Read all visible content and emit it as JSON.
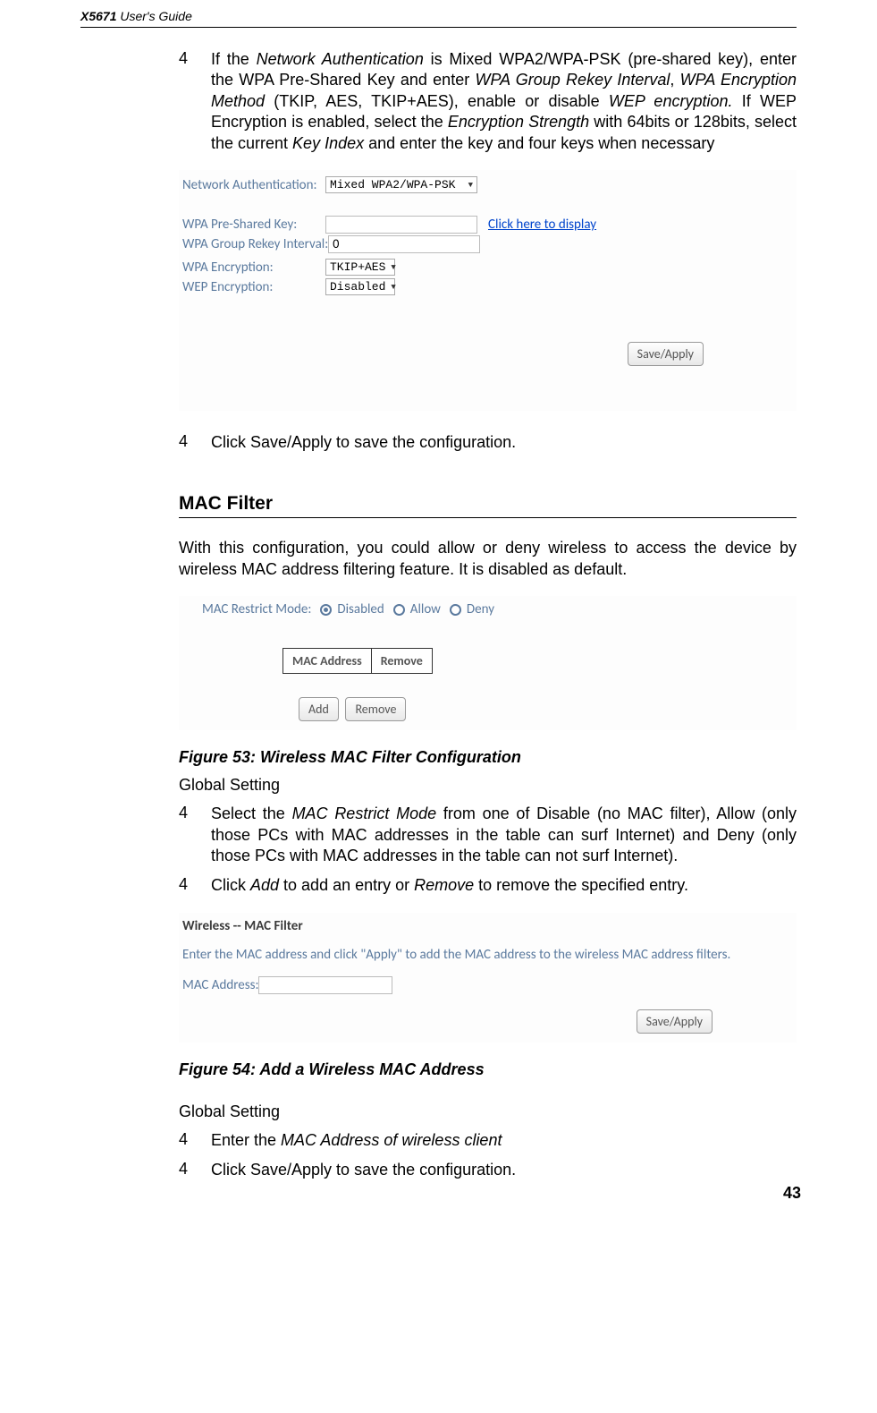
{
  "header": {
    "product_bold": "X5671",
    "product_rest": " User's Guide"
  },
  "step4a": {
    "num": "4",
    "t1": "If the ",
    "i1": "Network Authentication",
    "t2": " is Mixed WPA2/WPA-PSK (pre-shared key), enter the WPA Pre-Shared Key and enter ",
    "i2": "WPA Group Rekey Interval",
    "t3": ", ",
    "i3": "WPA Encryption Method",
    "t4": " (TKIP, AES, TKIP+AES), enable or disable ",
    "i4": "WEP encryption.",
    "t5": " If WEP Encryption is enabled, select the ",
    "i5": "Encryption Strength",
    "t6": " with 64bits or 128bits, select the current ",
    "i6": "Key Index",
    "t7": " and enter the key and four keys when necessary"
  },
  "form1": {
    "labels": {
      "net_auth": "Network Authentication:",
      "psk": "WPA Pre-Shared Key:",
      "rekey": "WPA Group Rekey Interval:",
      "wpa_enc": "WPA Encryption:",
      "wep_enc": "WEP Encryption:"
    },
    "values": {
      "net_auth": "Mixed WPA2/WPA-PSK",
      "rekey": "0",
      "wpa_enc": "TKIP+AES",
      "wep_enc": "Disabled"
    },
    "link": "Click here to display",
    "save": "Save/Apply"
  },
  "step4b": {
    "num": "4",
    "text": "Click Save/Apply to save the configuration."
  },
  "mac_section": {
    "title": "MAC Filter",
    "intro": "With this configuration, you could allow or deny wireless to access the device by wireless MAC address filtering feature. It is disabled as default.",
    "restrict_label": "MAC Restrict Mode:",
    "options": {
      "disabled": "Disabled",
      "allow": "Allow",
      "deny": "Deny"
    },
    "table": {
      "col1": "MAC Address",
      "col2": "Remove"
    },
    "buttons": {
      "add": "Add",
      "remove": "Remove"
    }
  },
  "fig53": "Figure 53: Wireless MAC Filter Configuration",
  "global1": "Global Setting",
  "mac_step1": {
    "num": "4",
    "t1": "Select the ",
    "i1": "MAC Restrict Mode",
    "t2": " from one of Disable (no MAC filter), Allow (only those PCs with MAC addresses in the table can surf Internet) and Deny (only those PCs with MAC addresses in the table can not surf Internet)."
  },
  "mac_step2": {
    "num": "4",
    "t1": "Click ",
    "i1": "Add",
    "t2": " to add an entry or ",
    "i2": "Remove",
    "t3": " to remove the specified entry."
  },
  "form2": {
    "title": "Wireless -- MAC Filter",
    "desc": "Enter the MAC address and click \"Apply\" to add the MAC address to the wireless MAC address filters.",
    "label": "MAC Address:",
    "save": "Save/Apply"
  },
  "fig54": "Figure 54: Add a Wireless MAC Address",
  "global2": "Global Setting",
  "mac_step3": {
    "num": "4",
    "t1": "Enter the ",
    "i1": "MAC Address of wireless client"
  },
  "mac_step4": {
    "num": "4",
    "text": "Click Save/Apply to save the configuration."
  },
  "page_num": "43"
}
